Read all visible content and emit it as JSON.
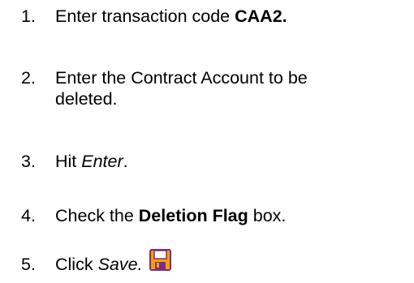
{
  "steps": [
    {
      "number": "1.",
      "text": "Enter transaction code ",
      "bold": "CAA2."
    },
    {
      "number": "2.",
      "line1": "Enter the Contract Account to be",
      "line2": "deleted."
    },
    {
      "number": "3.",
      "text": "Hit ",
      "italic": "Enter",
      "after": "."
    },
    {
      "number": "4.",
      "text": "Check the ",
      "bold": "Deletion Flag",
      "after": " box."
    },
    {
      "number": "5.",
      "text": "Click ",
      "italic": "Save."
    }
  ],
  "icons": {
    "save": "save-icon"
  },
  "colors": {
    "save_icon_fill": "#f4a100",
    "save_icon_outline": "#7a2d86",
    "save_icon_panel": "#ffffff"
  }
}
